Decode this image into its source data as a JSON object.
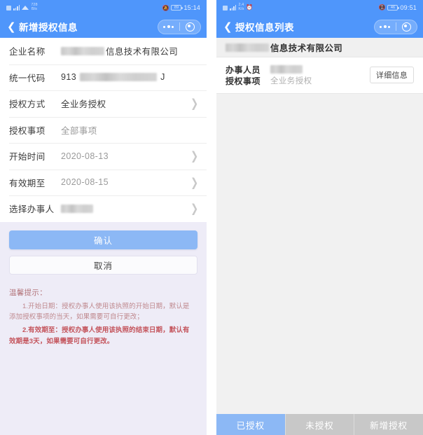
{
  "colors": {
    "header_blue": "#4f96fb",
    "primary_button": "#8cb8f5",
    "tip_area_bg": "#eeecf7",
    "list_bg": "#f1f1f1",
    "tab_inactive": "#c8c8c8",
    "tip_red": "#c4545c"
  },
  "left_screen": {
    "statusbar": {
      "network_rate": "728",
      "network_rate_unit": "B/s",
      "battery_text": "89",
      "time": "15:14",
      "mute_icon": "bell-off-icon",
      "signal_icon": "signal-bars-icon",
      "wifi_icon": "wifi-icon",
      "sim_icon": "sim-card-icon"
    },
    "navbar": {
      "back_icon": "chevron-left-icon",
      "title": "新增授权信息",
      "menu_icon": "more-dots-icon",
      "target_icon": "target-circle-icon"
    },
    "form": {
      "rows": [
        {
          "label": "企业名称",
          "value": "信息技术有限公司",
          "masked_prefix": true,
          "mask_width": 62,
          "chevron": false,
          "value_dark": true
        },
        {
          "label": "统一代码",
          "value_prefix": "913",
          "value_suffix": "J",
          "masked_middle": true,
          "mask_width": 110,
          "chevron": false,
          "value_dark": true
        },
        {
          "label": "授权方式",
          "value": "全业务授权",
          "chevron": true,
          "value_dark": true
        },
        {
          "label": "授权事项",
          "value": "全部事项",
          "chevron": false,
          "value_dark": false
        },
        {
          "label": "开始时间",
          "value": "2020-08-13",
          "chevron": true,
          "value_dark": false
        },
        {
          "label": "有效期至",
          "value": "2020-08-15",
          "chevron": true,
          "value_dark": false
        },
        {
          "label": "选择办事人",
          "value": "",
          "masked_only": true,
          "mask_width": 46,
          "chevron": true,
          "value_dark": false
        }
      ]
    },
    "actions": {
      "confirm_label": "确认",
      "cancel_label": "取消"
    },
    "tips": {
      "title": "温馨提示：",
      "item_1": "1.开始日期：授权办事人使用该执照的开始日期，默认是添加授权事项的当天，如果需要可自行更改；",
      "item_2": "2.有效期至：授权办事人使用该执照的结束日期，默认有效期是3天，如果需要可自行更改。"
    }
  },
  "right_screen": {
    "statusbar": {
      "network_rate": "2.4",
      "network_rate_unit": "K/s",
      "battery_text": "46",
      "time": "09:51",
      "alarm_icon": "alarm-clock-icon",
      "vibrate_icon": "vibrate-icon",
      "signal_icon": "signal-bars-icon",
      "sim_icon": "sim-card-icon"
    },
    "navbar": {
      "back_icon": "chevron-left-icon",
      "title": "授权信息列表",
      "menu_icon": "more-dots-icon",
      "target_icon": "target-circle-icon"
    },
    "company_bar": {
      "name": "信息技术有限公司",
      "masked_prefix": true,
      "mask_width": 62
    },
    "auth_item": {
      "person_label": "办事人员",
      "person_value": "",
      "person_masked": true,
      "person_mask_width": 46,
      "matter_label": "授权事项",
      "matter_value": "全业务授权",
      "detail_button": "详细信息"
    },
    "tabs": [
      {
        "label": "已授权",
        "active": true
      },
      {
        "label": "未授权",
        "active": false
      },
      {
        "label": "新增授权",
        "active": false
      }
    ]
  }
}
